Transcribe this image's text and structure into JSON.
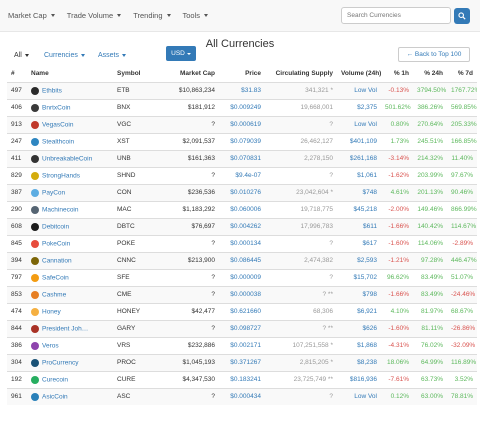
{
  "nav": {
    "items": [
      {
        "label": "Market Cap"
      },
      {
        "label": "Trade Volume"
      },
      {
        "label": "Trending"
      },
      {
        "label": "Tools"
      }
    ],
    "search_placeholder": "Search Currencies"
  },
  "toolbar": {
    "title": "All Currencies",
    "all_label": "All",
    "currencies_label": "Currencies",
    "assets_label": "Assets",
    "usd_label": "USD",
    "back_label": "← Back to Top 100"
  },
  "table": {
    "headers": [
      "#",
      "Name",
      "Symbol",
      "Market Cap",
      "Price",
      "Circulating Supply",
      "Volume (24h)",
      "% 1h",
      "% 24h",
      "% 7d"
    ],
    "rows": [
      {
        "rank": "497",
        "name": "Ethbits",
        "symbol": "ETB",
        "mcap": "$10,863,234",
        "price": "$31.83",
        "supply": "341,321 *",
        "volume": "Low Vol",
        "h1": "-0.13%",
        "h24": "3794.50%",
        "d7": "1767.72%",
        "icon": "#2b2b2b"
      },
      {
        "rank": "406",
        "name": "BnrtxCoin",
        "symbol": "BNX",
        "mcap": "$181,912",
        "price": "$0.009249",
        "supply": "19,668,001",
        "volume": "$2,375",
        "h1": "501.62%",
        "h24": "386.26%",
        "d7": "569.85%",
        "icon": "#3a3a3a"
      },
      {
        "rank": "913",
        "name": "VegasCoin",
        "symbol": "VGC",
        "mcap": "?",
        "price": "$0.000619",
        "supply": "?",
        "volume": "Low Vol",
        "h1": "0.80%",
        "h24": "270.64%",
        "d7": "205.33%",
        "icon": "#c0392b"
      },
      {
        "rank": "247",
        "name": "Stealthcoin",
        "symbol": "XST",
        "mcap": "$2,091,537",
        "price": "$0.079039",
        "supply": "26,462,127",
        "volume": "$401,109",
        "h1": "1.73%",
        "h24": "245.51%",
        "d7": "166.85%",
        "icon": "#2e86c1"
      },
      {
        "rank": "411",
        "name": "UnbreakableCoin",
        "symbol": "UNB",
        "mcap": "$161,363",
        "price": "$0.070831",
        "supply": "2,278,150",
        "volume": "$261,168",
        "h1": "-3.14%",
        "h24": "214.32%",
        "d7": "11.40%",
        "icon": "#333333"
      },
      {
        "rank": "829",
        "name": "StrongHands",
        "symbol": "SHND",
        "mcap": "?",
        "price": "$9.4e-07",
        "supply": "?",
        "volume": "$1,061",
        "h1": "-1.62%",
        "h24": "203.99%",
        "d7": "97.67%",
        "icon": "#d4ac0d"
      },
      {
        "rank": "387",
        "name": "PayCon",
        "symbol": "CON",
        "mcap": "$236,536",
        "price": "$0.010276",
        "supply": "23,042,604 *",
        "volume": "$748",
        "h1": "4.61%",
        "h24": "201.13%",
        "d7": "90.46%",
        "icon": "#5dade2"
      },
      {
        "rank": "290",
        "name": "Machinecoin",
        "symbol": "MAC",
        "mcap": "$1,183,292",
        "price": "$0.060006",
        "supply": "19,718,775",
        "volume": "$45,218",
        "h1": "-2.00%",
        "h24": "149.46%",
        "d7": "866.99%",
        "icon": "#566573"
      },
      {
        "rank": "608",
        "name": "Debitcoin",
        "symbol": "DBTC",
        "mcap": "$76,697",
        "price": "$0.004262",
        "supply": "17,996,783",
        "volume": "$611",
        "h1": "-1.66%",
        "h24": "140.42%",
        "d7": "114.67%",
        "icon": "#1c1c1c"
      },
      {
        "rank": "845",
        "name": "PokeCoin",
        "symbol": "POKE",
        "mcap": "?",
        "price": "$0.000134",
        "supply": "?",
        "volume": "$617",
        "h1": "-1.60%",
        "h24": "114.06%",
        "d7": "-2.89%",
        "icon": "#e74c3c"
      },
      {
        "rank": "394",
        "name": "Cannation",
        "symbol": "CNNC",
        "mcap": "$213,900",
        "price": "$0.086445",
        "supply": "2,474,382",
        "volume": "$2,593",
        "h1": "-1.21%",
        "h24": "97.28%",
        "d7": "446.47%",
        "icon": "#7d6608"
      },
      {
        "rank": "797",
        "name": "SafeCoin",
        "symbol": "SFE",
        "mcap": "?",
        "price": "$0.000009",
        "supply": "?",
        "volume": "$15,702",
        "h1": "96.62%",
        "h24": "83.49%",
        "d7": "51.07%",
        "icon": "#f39c12"
      },
      {
        "rank": "853",
        "name": "Cashme",
        "symbol": "CME",
        "mcap": "?",
        "price": "$0.000038",
        "supply": "? **",
        "volume": "$798",
        "h1": "-1.66%",
        "h24": "83.49%",
        "d7": "-24.46%",
        "icon": "#e67e22"
      },
      {
        "rank": "474",
        "name": "Honey",
        "symbol": "HONEY",
        "mcap": "$42,477",
        "price": "$0.621660",
        "supply": "68,306",
        "volume": "$6,921",
        "h1": "4.10%",
        "h24": "81.97%",
        "d7": "68.67%",
        "icon": "#f5b041"
      },
      {
        "rank": "844",
        "name": "President Joh…",
        "symbol": "GARY",
        "mcap": "?",
        "price": "$0.098727",
        "supply": "? **",
        "volume": "$626",
        "h1": "-1.60%",
        "h24": "81.11%",
        "d7": "-26.86%",
        "icon": "#a93226"
      },
      {
        "rank": "386",
        "name": "Veros",
        "symbol": "VRS",
        "mcap": "$232,886",
        "price": "$0.002171",
        "supply": "107,251,558 *",
        "volume": "$1,868",
        "h1": "-4.31%",
        "h24": "76.02%",
        "d7": "-32.09%",
        "icon": "#8e44ad"
      },
      {
        "rank": "304",
        "name": "ProCurrency",
        "symbol": "PROC",
        "mcap": "$1,045,193",
        "price": "$0.371267",
        "supply": "2,815,205 *",
        "volume": "$8,238",
        "h1": "18.06%",
        "h24": "64.99%",
        "d7": "116.89%",
        "icon": "#1a5276"
      },
      {
        "rank": "192",
        "name": "Curecoin",
        "symbol": "CURE",
        "mcap": "$4,347,530",
        "price": "$0.183241",
        "supply": "23,725,749 **",
        "volume": "$816,936",
        "h1": "-7.61%",
        "h24": "63.73%",
        "d7": "3.52%",
        "icon": "#27ae60"
      },
      {
        "rank": "961",
        "name": "AsicCoin",
        "symbol": "ASC",
        "mcap": "?",
        "price": "$0.000434",
        "supply": "?",
        "volume": "Low Vol",
        "h1": "0.12%",
        "h24": "63.00%",
        "d7": "78.81%",
        "icon": "#2980b9"
      }
    ]
  }
}
